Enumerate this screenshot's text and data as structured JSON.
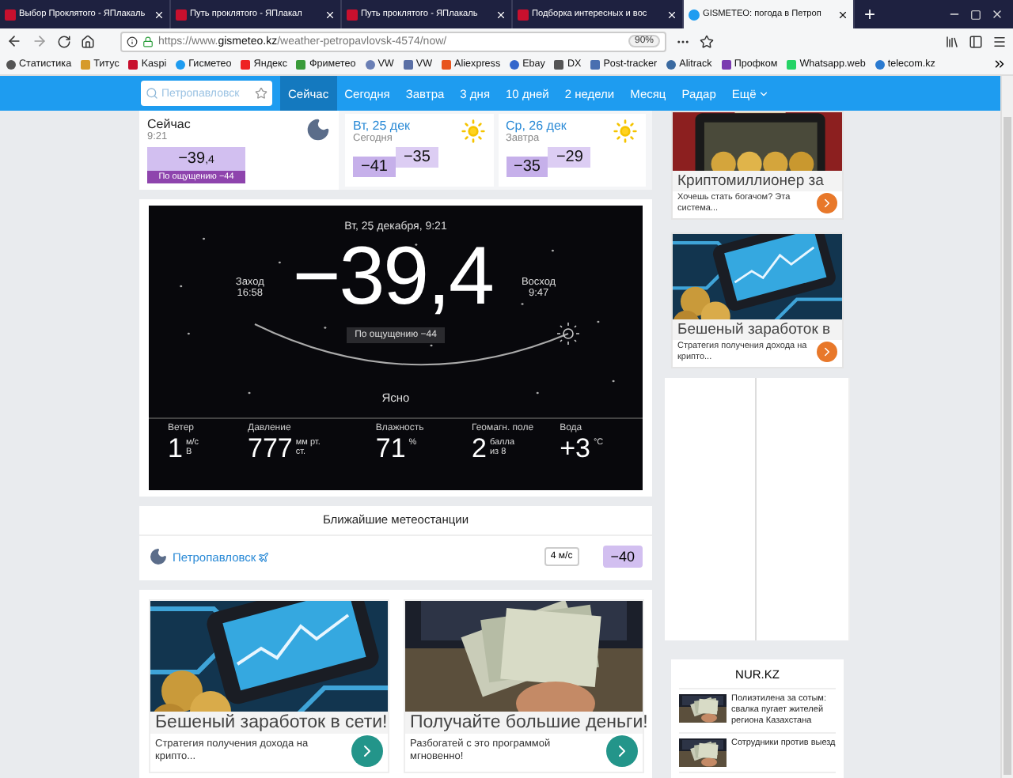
{
  "browser": {
    "tabs": [
      {
        "title": "Выбор Проклятого - ЯПлакаль",
        "selected": false
      },
      {
        "title": "Путь проклятого - ЯПлакал",
        "selected": false
      },
      {
        "title": "Путь проклятого - ЯПлакаль",
        "selected": false
      },
      {
        "title": "Подборка интересных и вос",
        "selected": false
      },
      {
        "title": "GISMETEO: погода в Петроп",
        "selected": true
      }
    ],
    "new_tab": "+",
    "url": {
      "scheme": "https://www.",
      "host": "gismeteo.kz",
      "path": "/weather-petropavlovsk-4574/now/"
    },
    "zoom": "90%",
    "bookmarks": [
      "Статистика",
      "Титус",
      "Kaspi",
      "Гисметео",
      "Яндекс",
      "Фриметео",
      "VW",
      "VW",
      "Aliexpress",
      "Ebay",
      "DX",
      "Post-tracker",
      "Alitrack",
      "Профком",
      "Whatsapp.web",
      "telecom.kz"
    ]
  },
  "nav": {
    "search": {
      "placeholder": "Петропавловск"
    },
    "items": [
      {
        "label": "Сейчас",
        "selected": true
      },
      {
        "label": "Сегодня",
        "selected": false
      },
      {
        "label": "Завтра",
        "selected": false
      },
      {
        "label": "3 дня",
        "selected": false
      },
      {
        "label": "10 дней",
        "selected": false
      },
      {
        "label": "2 недели",
        "selected": false
      },
      {
        "label": "Месяц",
        "selected": false
      },
      {
        "label": "Радар",
        "selected": false
      }
    ],
    "more": "Ещё"
  },
  "now": {
    "label": "Сейчас",
    "time": "9:21",
    "temp": "−39",
    "temp_fraction": ",4",
    "feels": "По ощущению −44"
  },
  "forecast": [
    {
      "day": "Вт, 25 дек",
      "sub": "Сегодня",
      "low": "−41",
      "high": "−35"
    },
    {
      "day": "Ср, 26 дек",
      "sub": "Завтра",
      "low": "−35",
      "high": "−29"
    }
  ],
  "current": {
    "date": "Вт, 25 декабря, 9:21",
    "temp": "−39,4",
    "sunset": {
      "label": "Заход",
      "time": "16:58"
    },
    "sunrise": {
      "label": "Восход",
      "time": "9:47"
    },
    "feels": "По ощущению −44",
    "condition": "Ясно",
    "stats": [
      {
        "label": "Ветер",
        "value": "1",
        "unit": "м/с",
        "unit_sub": "В"
      },
      {
        "label": "Давление",
        "value": "777",
        "unit": "мм рт.",
        "unit_sub": "ст."
      },
      {
        "label": "Влажность",
        "value": "71",
        "unit": "%"
      },
      {
        "label": "Геомагн. поле",
        "value": "2",
        "unit": "балла",
        "unit_sub": "из 8"
      },
      {
        "label": "Вода",
        "value": "+3",
        "unit": "°C"
      }
    ]
  },
  "stations": {
    "title": "Ближайшие метеостанции",
    "items": [
      {
        "name": "Петропавловск",
        "wind": "4 м/с",
        "temp": "−40"
      }
    ]
  },
  "ads": [
    {
      "title": "Бешеный заработок в сети!",
      "text": "Стратегия получения дохода на крипто..."
    },
    {
      "title": "Получайте большие деньги!",
      "text": "Разбогатей с это программой мгновенно!"
    }
  ],
  "side_ads": [
    {
      "title": "Криптомиллионер за",
      "text": "Хочешь стать богачом? Эта система..."
    },
    {
      "title": "Бешеный заработок в",
      "text": "Стратегия получения дохода на крипто..."
    }
  ],
  "news": {
    "title": "NUR.KZ",
    "items": [
      {
        "text": "Полиэтилена за сотым: свалка пугает жителей региона Казахстана"
      },
      {
        "text": "Сотрудники против выезд"
      }
    ]
  }
}
